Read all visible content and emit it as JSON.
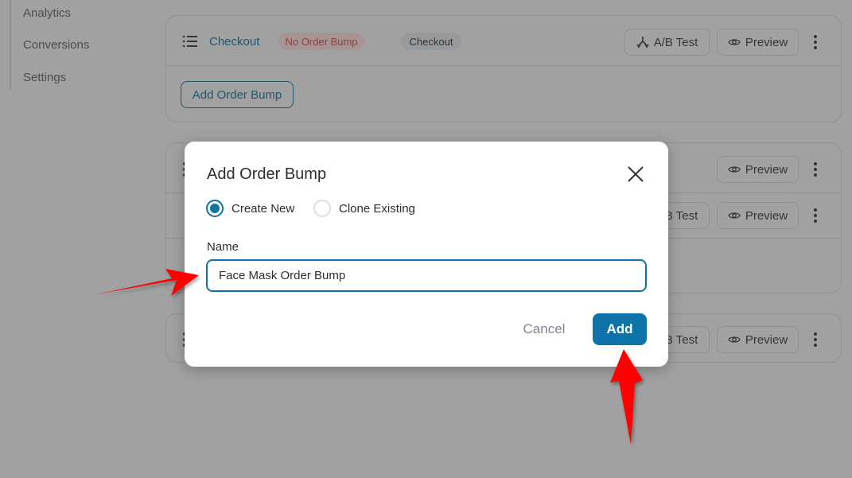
{
  "sidebar": {
    "items": [
      {
        "label": "Analytics"
      },
      {
        "label": "Conversions"
      },
      {
        "label": "Settings"
      }
    ]
  },
  "steps": [
    {
      "name": "Checkout",
      "status_badge": "No Order Bump",
      "type_badge": "Checkout",
      "ab_test_label": "A/B Test",
      "preview_label": "Preview",
      "add_order_bump_label": "Add Order Bump"
    },
    {
      "rows": [
        {
          "preview_label": "Preview"
        },
        {
          "ab_test_label": "A/B Test",
          "preview_label": "Preview"
        }
      ]
    },
    {
      "ab_test_label": "A/B Test",
      "preview_label": "Preview"
    }
  ],
  "modal": {
    "title": "Add Order Bump",
    "options": [
      {
        "label": "Create New",
        "selected": true
      },
      {
        "label": "Clone Existing",
        "selected": false
      }
    ],
    "name_label": "Name",
    "name_value": "Face Mask Order Bump",
    "cancel_label": "Cancel",
    "add_label": "Add"
  },
  "colors": {
    "accent": "#0e73a9",
    "annotation_arrow": "#ff0000",
    "badge_red_text": "#c44b41"
  }
}
